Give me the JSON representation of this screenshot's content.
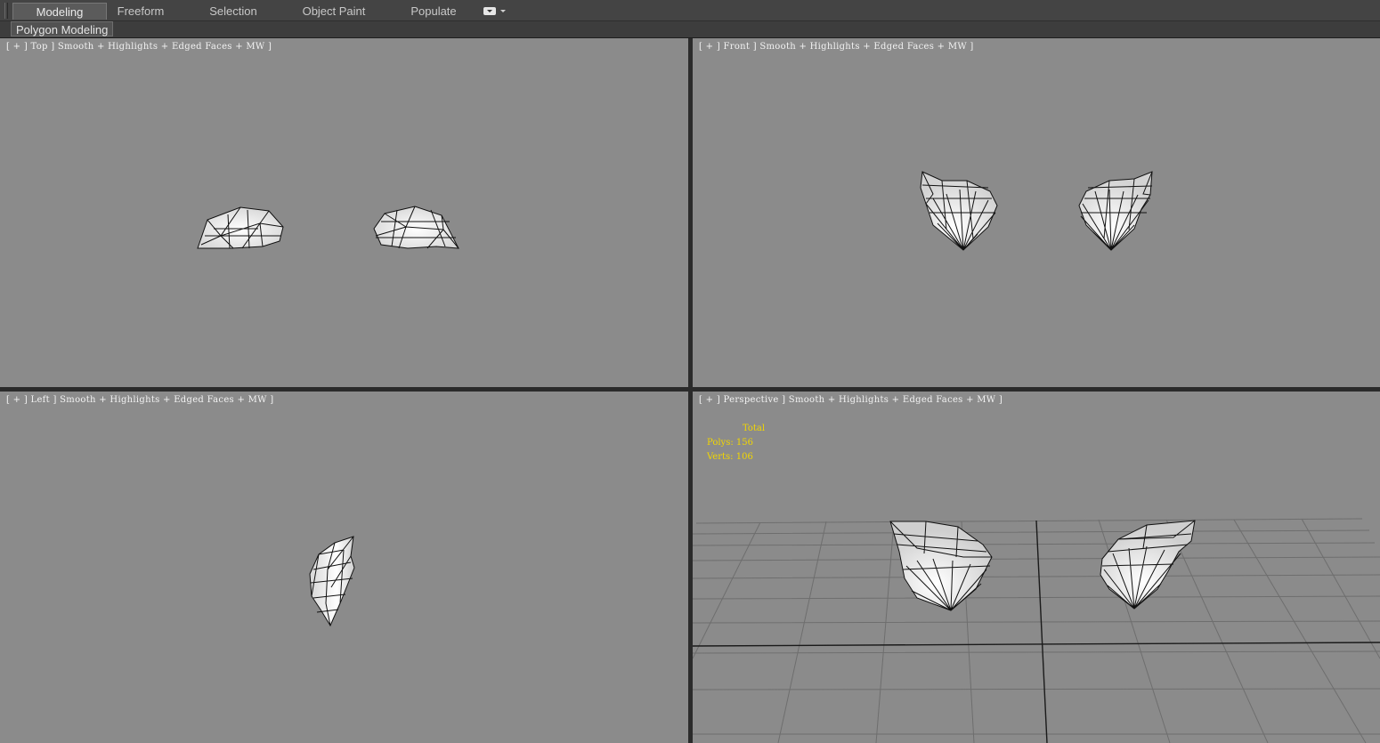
{
  "ribbon": {
    "tabs": [
      {
        "label": "Modeling",
        "active": true
      },
      {
        "label": "Freeform",
        "active": false
      },
      {
        "label": "Selection",
        "active": false
      },
      {
        "label": "Object Paint",
        "active": false
      },
      {
        "label": "Populate",
        "active": false
      }
    ],
    "overflow_icon": "dropdown-menu-icon",
    "panel_label": "Polygon Modeling"
  },
  "viewports": {
    "top": {
      "label": "[ + ] Top ] Smooth + Highlights + Edged Faces + MW ]"
    },
    "front": {
      "label": "[ + ] Front ] Smooth + Highlights + Edged Faces + MW ]"
    },
    "left": {
      "label": "[ + ] Left ] Smooth + Highlights + Edged Faces + MW ]"
    },
    "perspective": {
      "label": "[ + ] Perspective ] Smooth + Highlights + Edged Faces + MW ]"
    }
  },
  "statistics": {
    "header": "Total",
    "polys_label": "Polys:",
    "polys_value": "156",
    "verts_label": "Verts:",
    "verts_value": "106"
  },
  "colors": {
    "viewport_bg": "#8b8b8b",
    "stats_text": "#f2d600",
    "ui_bg": "#444444"
  }
}
